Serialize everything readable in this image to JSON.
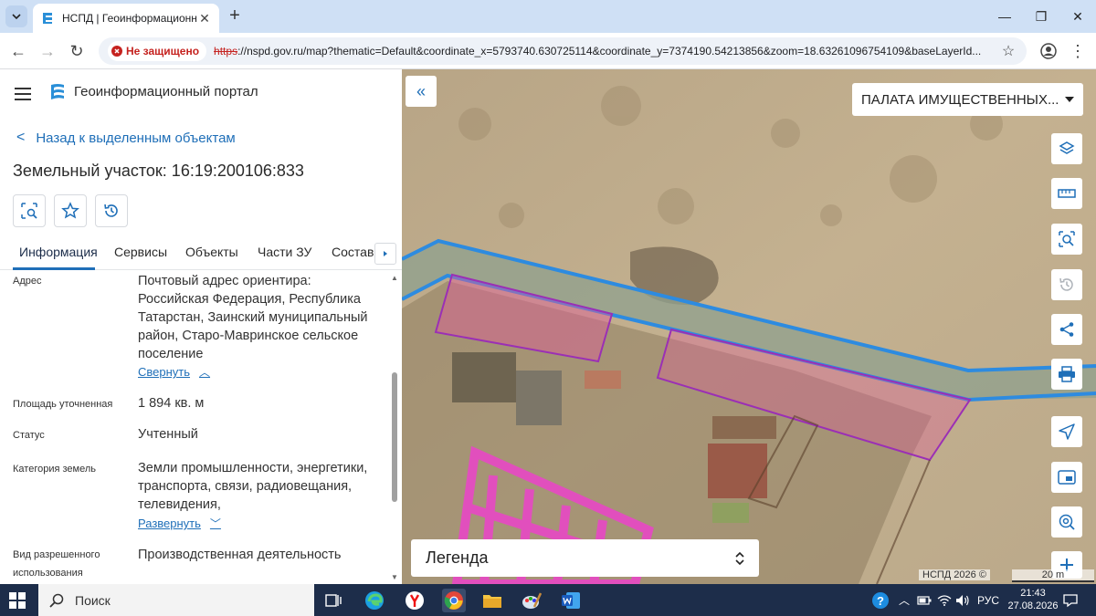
{
  "browser": {
    "tab_title": "НСПД | Геоинформационный",
    "insecure_label": "Не защищено",
    "url_protocol": "https",
    "url_rest": "://nspd.gov.ru/map?thematic=Default&coordinate_x=5793740.630725114&coordinate_y=7374190.54213856&zoom=18.63261096754109&baseLayerId..."
  },
  "portal": {
    "title": "Геоинформационный портал",
    "back_label": "Назад к выделенным объектам",
    "object_title": "Земельный участок: 16:19:200106:833",
    "tabs": [
      "Информация",
      "Сервисы",
      "Объекты",
      "Части ЗУ",
      "Состав"
    ]
  },
  "info": {
    "address_label": "Адрес",
    "address_value": "Почтовый адрес ориентира: Российская Федерация, Республика Татарстан, Заинский муниципальный район, Старо-Мавринское сельское поселение",
    "collapse_link": "Свернуть",
    "area_label": "Площадь уточненная",
    "area_value": "1 894 кв. м",
    "status_label": "Статус",
    "status_value": "Учтенный",
    "category_label": "Категория земель",
    "category_value": "Земли промышленности, энергетики, транспорта, связи, радиовещания, телевидения,",
    "expand_link": "Развернуть",
    "usage_label": "Вид разрешенного использования",
    "usage_value": "Производственная деятельность"
  },
  "map": {
    "layer_select": "ПАЛАТА ИМУЩЕСТВЕННЫХ...",
    "legend_title": "Легенда",
    "attribution": "НСПД 2026 ©",
    "scale_label": "20 m",
    "tool_icons": [
      "layers-icon",
      "ruler-icon",
      "area-search-icon",
      "history-icon",
      "share-icon",
      "print-icon",
      "locate-icon",
      "minimap-icon",
      "target-zoom-icon",
      "zoom-in-icon"
    ]
  },
  "taskbar": {
    "search_placeholder": "Поиск",
    "language": "РУС",
    "time": "21:43",
    "date": "27.08.2026"
  },
  "colors": {
    "accent": "#1f6fb8",
    "parcel_fill": "#e05a9a",
    "parcel_stroke": "#9b2fb5",
    "road_stroke": "#2d8be0",
    "taskbar": "#1d2d4a"
  }
}
